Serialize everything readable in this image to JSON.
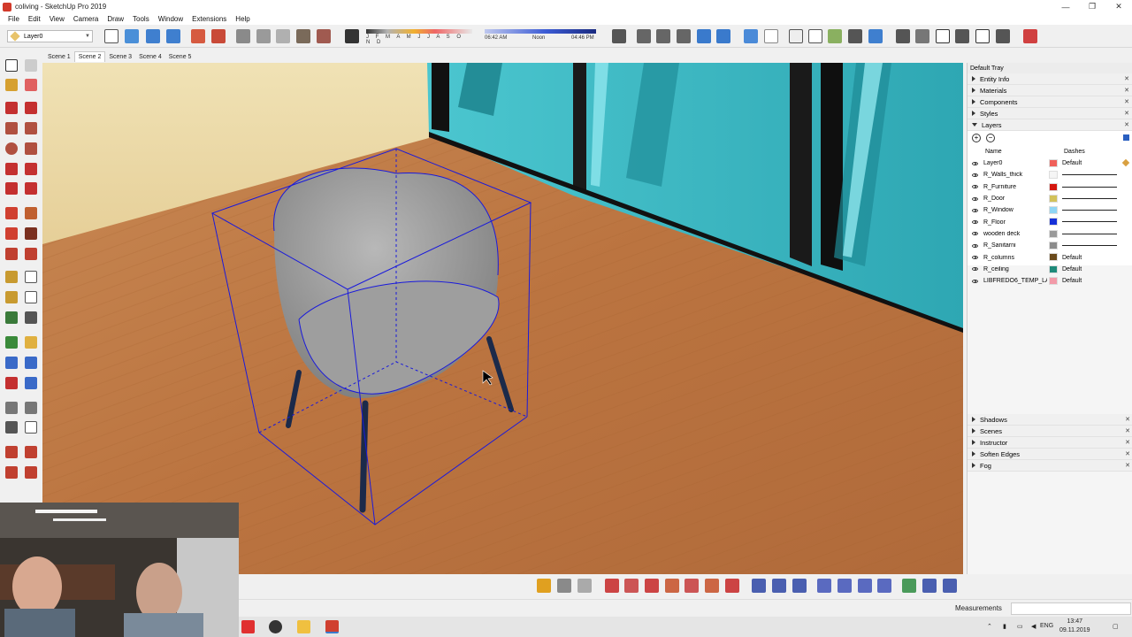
{
  "window": {
    "title": "coliving - SketchUp Pro 2019",
    "controls": [
      "—",
      "❐",
      "✕"
    ]
  },
  "menu": [
    "File",
    "Edit",
    "View",
    "Camera",
    "Draw",
    "Tools",
    "Window",
    "Extensions",
    "Help"
  ],
  "toolbar": {
    "layer_selector": "Layer0",
    "shadow_months": "J F M A M J J A S O N D",
    "time_start": "06:42 AM",
    "time_mid": "Noon",
    "time_end": "04:46 PM"
  },
  "scenes": {
    "tabs": [
      "Scene 1",
      "Scene 2",
      "Scene 3",
      "Scene 4",
      "Scene 5"
    ],
    "active": "Scene 2"
  },
  "tray": {
    "title": "Default Tray",
    "panels_top": [
      "Entity Info",
      "Materials",
      "Components",
      "Styles"
    ],
    "layers_panel": "Layers",
    "columns": {
      "name": "Name",
      "dashes": "Dashes"
    },
    "layers": [
      {
        "name": "Layer0",
        "color": "#f0605a",
        "dash": "Default"
      },
      {
        "name": "R_Walls_thick",
        "color": "#f5f5f5",
        "dash": ""
      },
      {
        "name": "R_Furniture",
        "color": "#d4170f",
        "dash": ""
      },
      {
        "name": "R_Door",
        "color": "#d2c25a",
        "dash": ""
      },
      {
        "name": "R_Window",
        "color": "#8fd6f5",
        "dash": ""
      },
      {
        "name": "R_Floor",
        "color": "#1631d8",
        "dash": ""
      },
      {
        "name": "wooden deck",
        "color": "#9a9a9a",
        "dash": ""
      },
      {
        "name": "R_Sanitarni",
        "color": "#8c8c8c",
        "dash": ""
      },
      {
        "name": "R_columns",
        "color": "#6a4a1c",
        "dash": "Default"
      },
      {
        "name": "R_ceiling",
        "color": "#1f8a7a",
        "dash": "Default"
      },
      {
        "name": "LIBFREDO6_TEMP_LA",
        "color": "#f29aa8",
        "dash": "Default"
      }
    ],
    "panels_bottom": [
      "Shadows",
      "Scenes",
      "Instructor",
      "Soften Edges",
      "Fog"
    ]
  },
  "status": {
    "measurements_label": "Measurements",
    "measurements_value": ""
  },
  "taskbar": {
    "lang": "ENG",
    "time": "13:47",
    "date": "09.11.2019"
  },
  "colors": {
    "selection": "#1a1adb",
    "floor": "#c07a45",
    "glass": "#33b8c4"
  }
}
